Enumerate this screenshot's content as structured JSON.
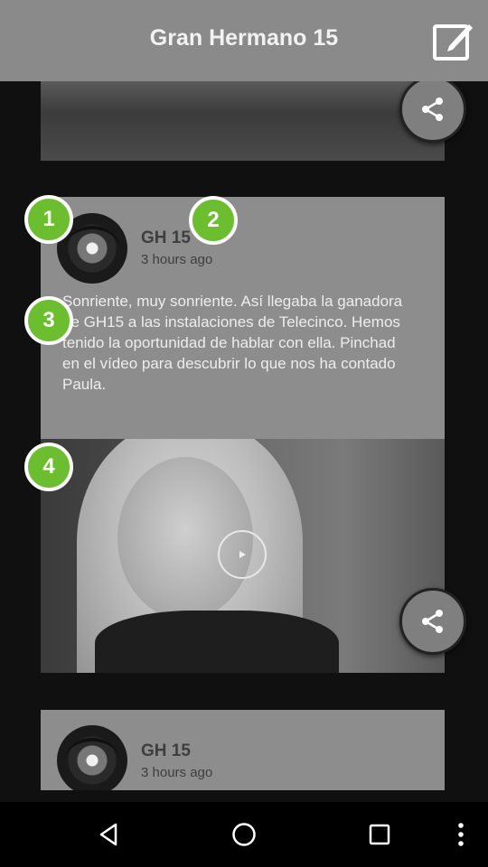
{
  "header": {
    "title": "Gran Hermano 15"
  },
  "icons": {
    "edit": "edit-square-icon",
    "share": "share-icon",
    "play": "play-icon",
    "back": "back-triangle-icon",
    "home": "home-circle-icon",
    "recents": "recents-square-icon",
    "overflow": "more-vertical-icon"
  },
  "markers": [
    "1",
    "2",
    "3",
    "4"
  ],
  "post": {
    "author": "GH 15",
    "time": "3 hours ago",
    "text": "Sonriente, muy sonriente. Así llegaba la ganadora de GH15 a las instalaciones de Telecinco. Hemos tenido la oportunidad de hablar con ella. Pinchad en el vídeo para descubrir lo que nos ha contado Paula."
  },
  "next_post": {
    "author": "GH 15",
    "time": "3 hours ago"
  },
  "colors": {
    "header_bg": "#8a8a8a",
    "card_bg": "#8d8d8d",
    "marker": "#6bbf2e"
  }
}
